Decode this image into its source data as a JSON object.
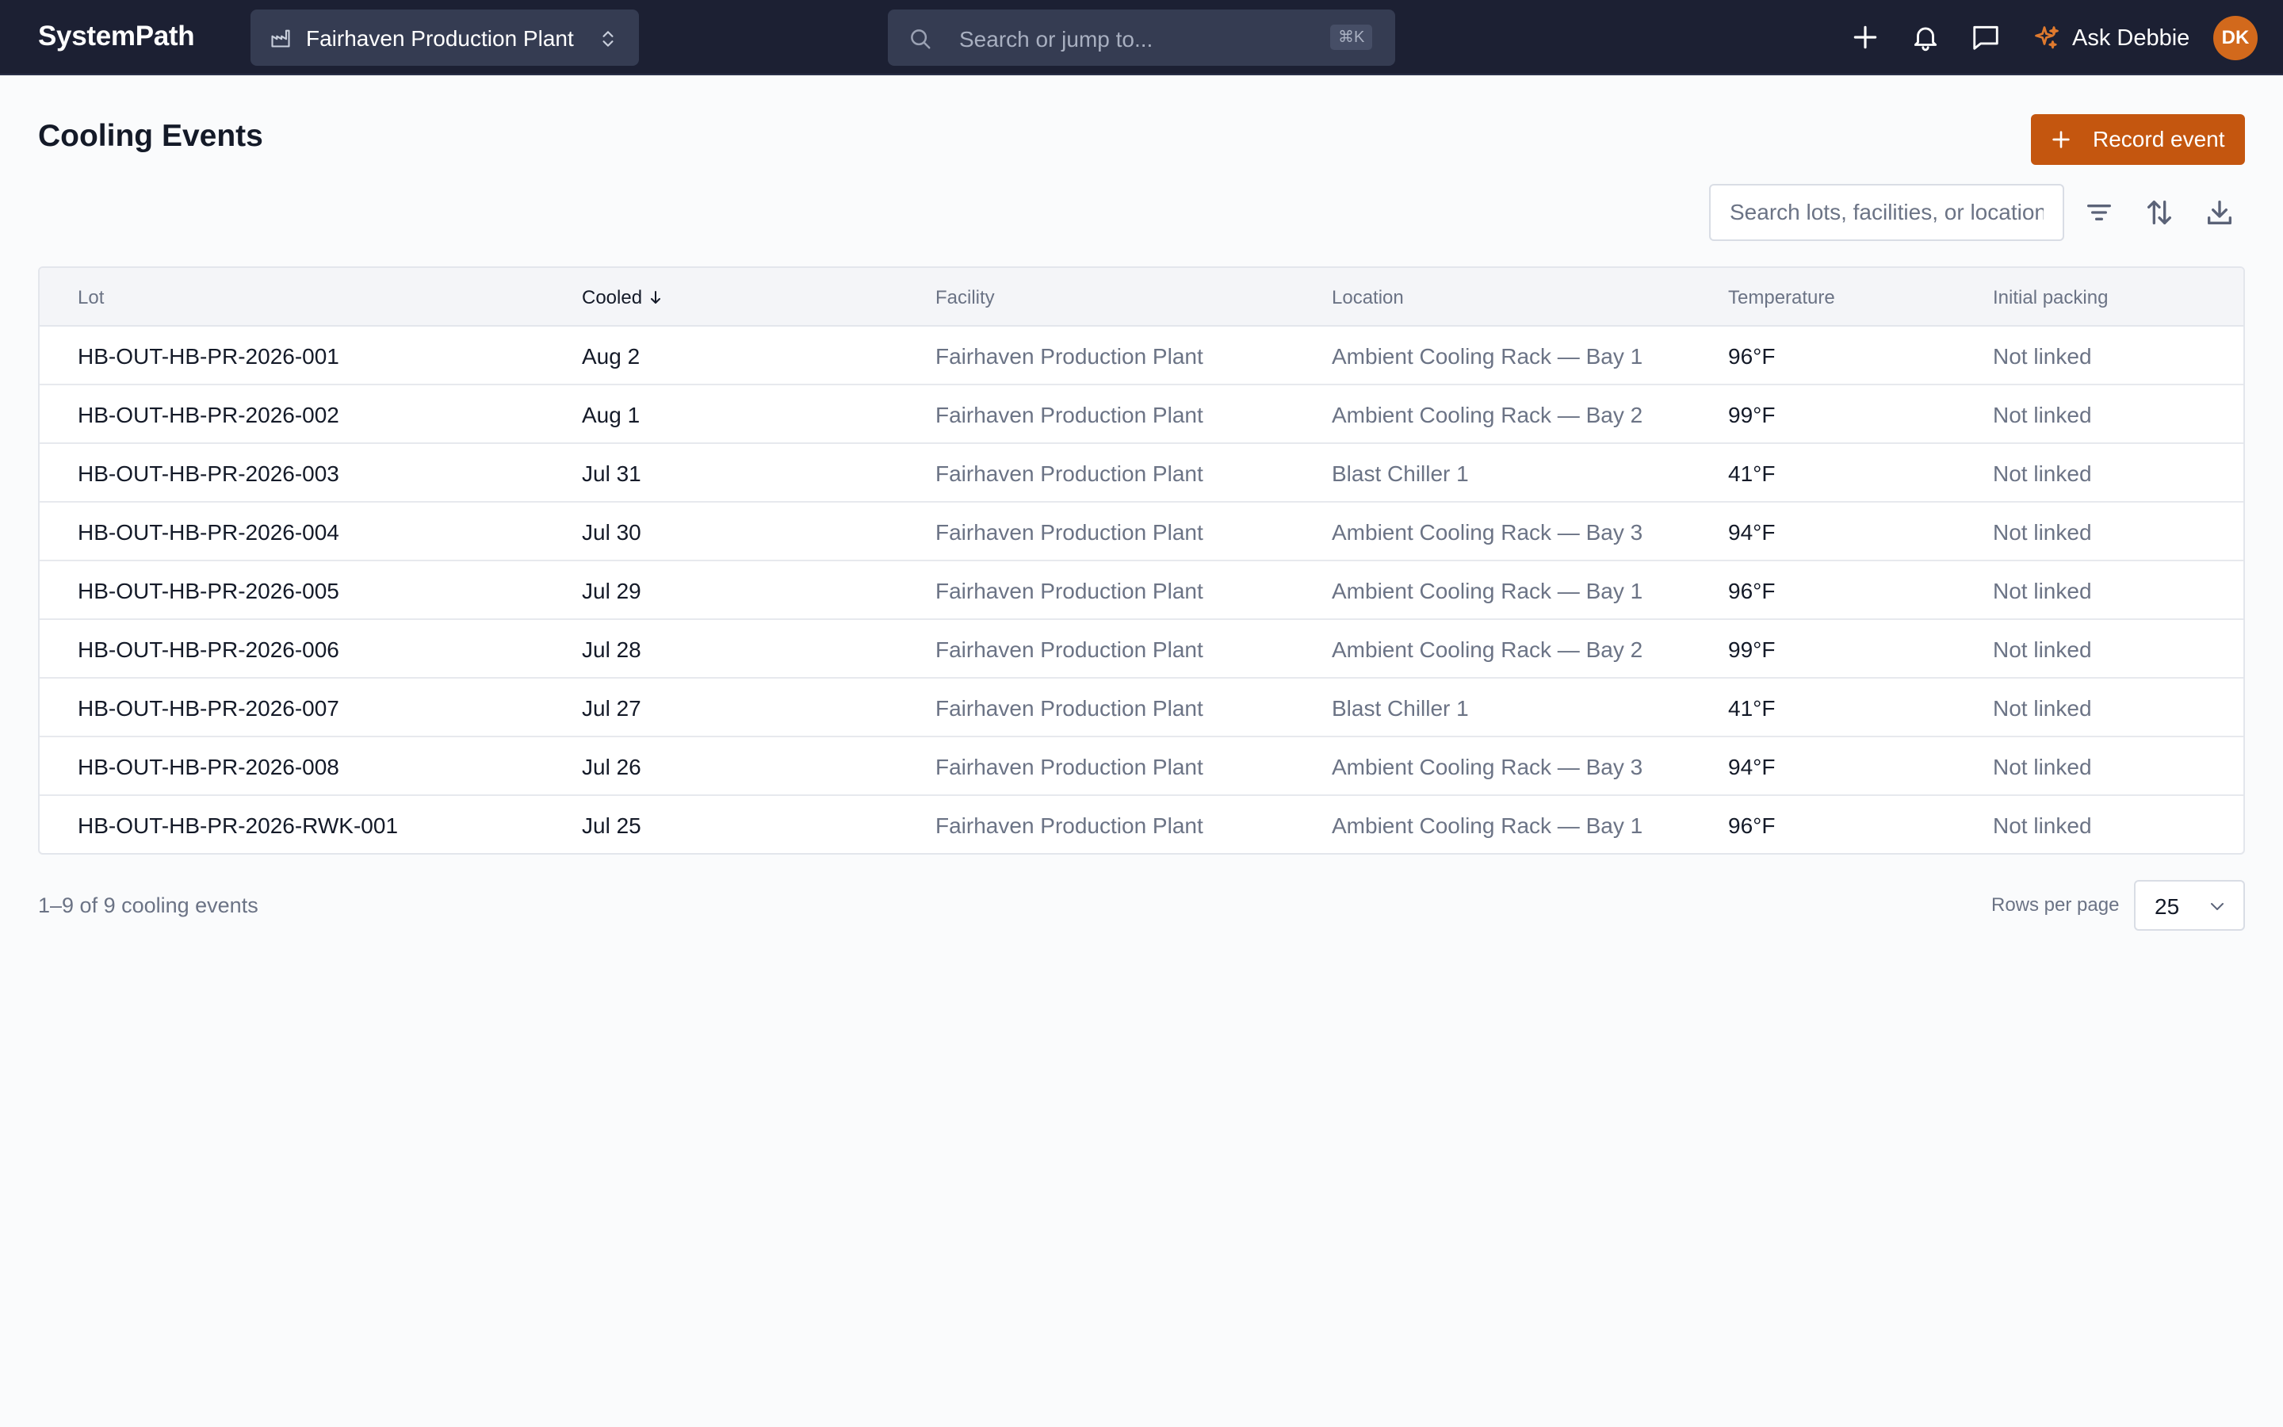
{
  "app": {
    "name": "SystemPath"
  },
  "facility_switcher": {
    "label": "Fairhaven Production Plant"
  },
  "search": {
    "placeholder": "Search or jump to...",
    "shortcut": "⌘K"
  },
  "assistant": {
    "label": "Ask Debbie"
  },
  "user": {
    "initials": "DK"
  },
  "page": {
    "title": "Cooling Events",
    "primary_action": "Record event",
    "table_search_placeholder": "Search lots, facilities, or locations"
  },
  "table": {
    "columns": {
      "lot": "Lot",
      "cooled": "Cooled",
      "facility": "Facility",
      "location": "Location",
      "temperature": "Temperature",
      "packing": "Initial packing"
    },
    "sorted_by": "cooled",
    "sort_direction": "desc",
    "rows": [
      {
        "lot": "HB-OUT-HB-PR-2026-001",
        "cooled": "Aug 2",
        "facility": "Fairhaven Production Plant",
        "location": "Ambient Cooling Rack — Bay 1",
        "temperature": "96°F",
        "packing": "Not linked"
      },
      {
        "lot": "HB-OUT-HB-PR-2026-002",
        "cooled": "Aug 1",
        "facility": "Fairhaven Production Plant",
        "location": "Ambient Cooling Rack — Bay 2",
        "temperature": "99°F",
        "packing": "Not linked"
      },
      {
        "lot": "HB-OUT-HB-PR-2026-003",
        "cooled": "Jul 31",
        "facility": "Fairhaven Production Plant",
        "location": "Blast Chiller 1",
        "temperature": "41°F",
        "packing": "Not linked"
      },
      {
        "lot": "HB-OUT-HB-PR-2026-004",
        "cooled": "Jul 30",
        "facility": "Fairhaven Production Plant",
        "location": "Ambient Cooling Rack — Bay 3",
        "temperature": "94°F",
        "packing": "Not linked"
      },
      {
        "lot": "HB-OUT-HB-PR-2026-005",
        "cooled": "Jul 29",
        "facility": "Fairhaven Production Plant",
        "location": "Ambient Cooling Rack — Bay 1",
        "temperature": "96°F",
        "packing": "Not linked"
      },
      {
        "lot": "HB-OUT-HB-PR-2026-006",
        "cooled": "Jul 28",
        "facility": "Fairhaven Production Plant",
        "location": "Ambient Cooling Rack — Bay 2",
        "temperature": "99°F",
        "packing": "Not linked"
      },
      {
        "lot": "HB-OUT-HB-PR-2026-007",
        "cooled": "Jul 27",
        "facility": "Fairhaven Production Plant",
        "location": "Blast Chiller 1",
        "temperature": "41°F",
        "packing": "Not linked"
      },
      {
        "lot": "HB-OUT-HB-PR-2026-008",
        "cooled": "Jul 26",
        "facility": "Fairhaven Production Plant",
        "location": "Ambient Cooling Rack — Bay 3",
        "temperature": "94°F",
        "packing": "Not linked"
      },
      {
        "lot": "HB-OUT-HB-PR-2026-RWK-001",
        "cooled": "Jul 25",
        "facility": "Fairhaven Production Plant",
        "location": "Ambient Cooling Rack — Bay 1",
        "temperature": "96°F",
        "packing": "Not linked"
      }
    ]
  },
  "footer": {
    "count_text": "1–9 of 9 cooling events",
    "rows_per_page_label": "Rows per page",
    "rows_per_page_value": "25"
  },
  "icons": {
    "facility": "factory-icon",
    "facility_chevron": "chevron-up-down-icon",
    "search": "search-icon",
    "add": "plus-icon",
    "notifications": "bell-icon",
    "messages": "chat-icon",
    "assistant": "sparkle-icon",
    "filter": "filter-icon",
    "sort": "sort-icon",
    "download": "download-icon"
  },
  "colors": {
    "topbar": "#1c2033",
    "accent": "#c4560f",
    "assistant_icon": "#e07a2e",
    "avatar": "#d2691c"
  }
}
